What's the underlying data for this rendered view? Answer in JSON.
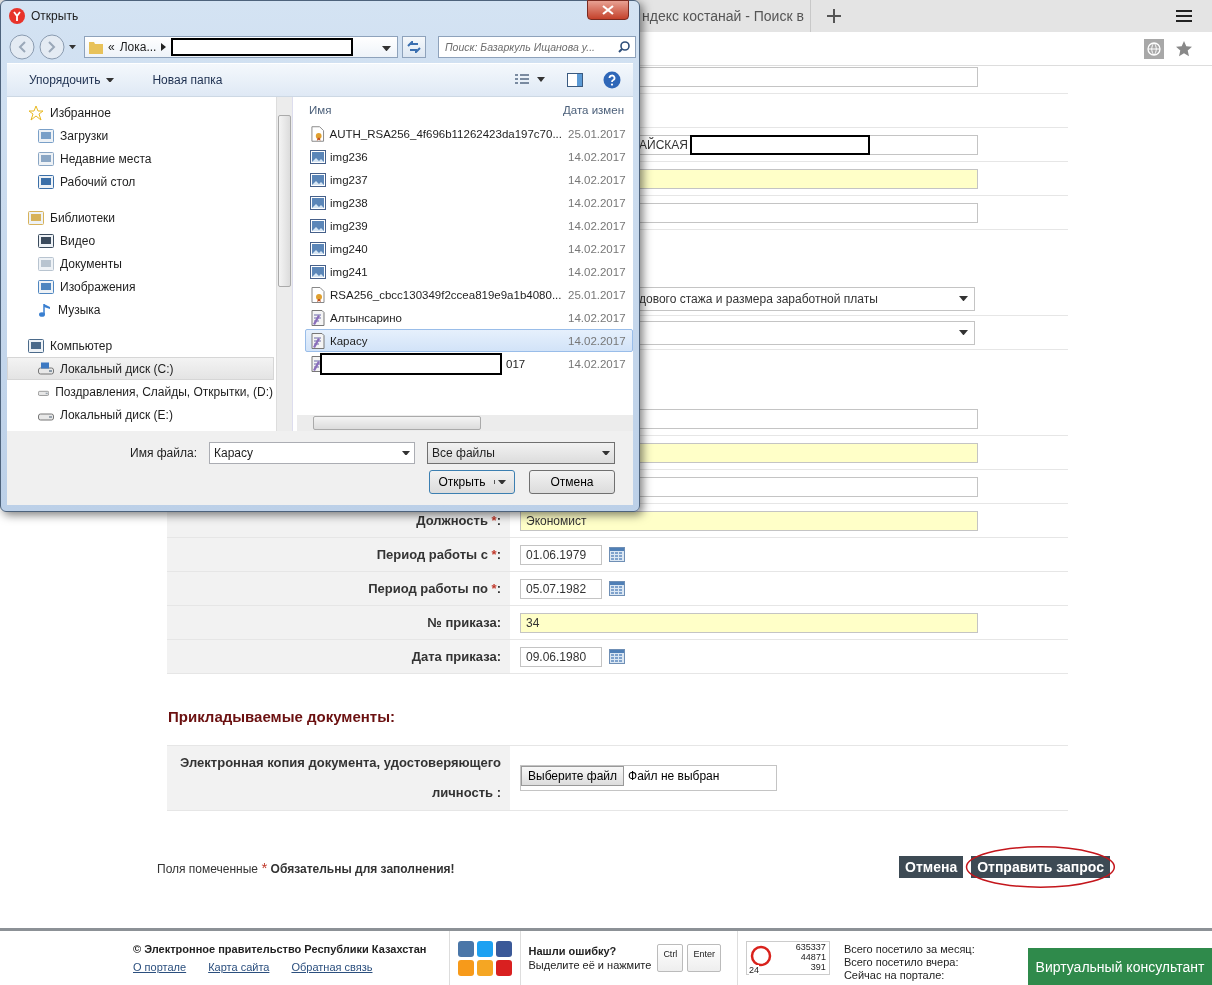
{
  "browser": {
    "tab_title": "ндекс костанай - Поиск в"
  },
  "form": {
    "groups": [
      [
        {
          "kind": "input",
          "highlighted": false
        },
        {
          "kind": "empty"
        },
        {
          "kind": "input",
          "highlighted": false,
          "value": "АЙСКАЯ",
          "redacted": true,
          "start_hidden": true
        },
        {
          "kind": "input",
          "highlighted": true
        },
        {
          "kind": "input",
          "highlighted": false
        }
      ],
      [
        {
          "kind": "select",
          "value": "дового стажа и размера заработной платы",
          "start_hidden": true
        },
        {
          "kind": "select"
        }
      ],
      [
        {
          "kind": "input",
          "highlighted": false
        },
        {
          "kind": "input",
          "highlighted": true
        },
        {
          "kind": "input",
          "highlighted": false
        },
        {
          "kind": "input",
          "label": "Должность",
          "mark": "*",
          "end": ":",
          "highlighted": true,
          "value": "Экономист"
        },
        {
          "kind": "date",
          "label": "Период работы с",
          "mark": "*",
          "end": ":",
          "value": "01.06.1979"
        },
        {
          "kind": "date",
          "label": "Период работы по",
          "mark": "*",
          "end": ":",
          "value": "05.07.1982"
        },
        {
          "kind": "input",
          "label": "№ приказа:",
          "highlighted": true,
          "value": "34"
        },
        {
          "kind": "date",
          "label": "Дата приказа:",
          "value": "09.06.1980"
        }
      ]
    ]
  },
  "documents": {
    "heading": "Прикладываемые документы:",
    "label_lines": [
      "Электронная копия документа, удостоверяющего",
      "личность :"
    ],
    "file_button": "Выберите файл",
    "file_status": "Файл не выбран"
  },
  "note": {
    "text": "Поля помеченные",
    "mark": "*",
    "emphasis": "Обязательны для заполнения!"
  },
  "buttons": [
    {
      "label": "Отмена",
      "circled": false
    },
    {
      "label": "Отправить запрос",
      "circled": true
    }
  ],
  "footer": {
    "copyright": "© Электронное правительство Республики Казахстан",
    "links": [
      "О портале",
      "Карта сайта",
      "Обратная связь"
    ],
    "error_title": "Нашли ошибку?",
    "error_text": "Выделите её и нажмите",
    "keys": [
      "Ctrl",
      "Enter"
    ],
    "counter": {
      "values": [
        "635337",
        "44871",
        "391"
      ],
      "corner": "24"
    },
    "stats": [
      "Всего посетило за месяц:",
      "Всего посетило вчера:",
      "Сейчас на портале:"
    ],
    "consultant": "Виртуальный консультант"
  },
  "dialog": {
    "title": "Открыть",
    "breadcrumb_prefix": "«",
    "breadcrumb": "Лока...",
    "search_placeholder": "Поиск: Базаркуль Ищанова у...",
    "organize": "Упорядочить",
    "new_folder": "Новая папка",
    "nav": [
      {
        "label": "Избранное",
        "selected": false,
        "children": [
          {
            "label": "Загрузки",
            "selected": false
          },
          {
            "label": "Недавние места",
            "selected": false
          },
          {
            "label": "Рабочий стол",
            "selected": false
          }
        ]
      },
      {
        "label": "Библиотеки",
        "selected": false,
        "children": [
          {
            "label": "Видео",
            "selected": false
          },
          {
            "label": "Документы",
            "selected": false
          },
          {
            "label": "Изображения",
            "selected": false
          },
          {
            "label": "Музыка",
            "selected": false
          }
        ]
      },
      {
        "label": "Компьютер",
        "selected": false,
        "children": [
          {
            "label": "Локальный диск (C:)",
            "selected": true
          },
          {
            "label": "Поздравления, Слайды, Открытки, (D:)",
            "selected": false
          },
          {
            "label": "Локальный диск (E:)",
            "selected": false
          }
        ]
      }
    ],
    "columns": [
      "Имя",
      "Дата измен"
    ],
    "files": [
      {
        "name": "AUTH_RSA256_4f696b11262423da197c70...",
        "date": "25.01.2017",
        "kind": "cert",
        "selected": false
      },
      {
        "name": "img236",
        "date": "14.02.2017",
        "kind": "image",
        "selected": false
      },
      {
        "name": "img237",
        "date": "14.02.2017",
        "kind": "image",
        "selected": false
      },
      {
        "name": "img238",
        "date": "14.02.2017",
        "kind": "image",
        "selected": false
      },
      {
        "name": "img239",
        "date": "14.02.2017",
        "kind": "image",
        "selected": false
      },
      {
        "name": "img240",
        "date": "14.02.2017",
        "kind": "image",
        "selected": false
      },
      {
        "name": "img241",
        "date": "14.02.2017",
        "kind": "image",
        "selected": false
      },
      {
        "name": "RSA256_cbcc130349f2ccea819e9a1b4080...",
        "date": "25.01.2017",
        "kind": "cert",
        "selected": false
      },
      {
        "name": "Алтынсарино",
        "date": "14.02.2017",
        "kind": "doc",
        "selected": false
      },
      {
        "name": "Карасу",
        "date": "14.02.2017",
        "kind": "doc",
        "selected": true
      },
      {
        "name": "017",
        "date": "14.02.2017",
        "kind": "doc",
        "selected": false,
        "redacted": true
      }
    ],
    "filename_label": "Имя файла:",
    "filename": "Карасу",
    "filetype": "Все файлы",
    "open": "Открыть",
    "cancel": "Отмена"
  }
}
